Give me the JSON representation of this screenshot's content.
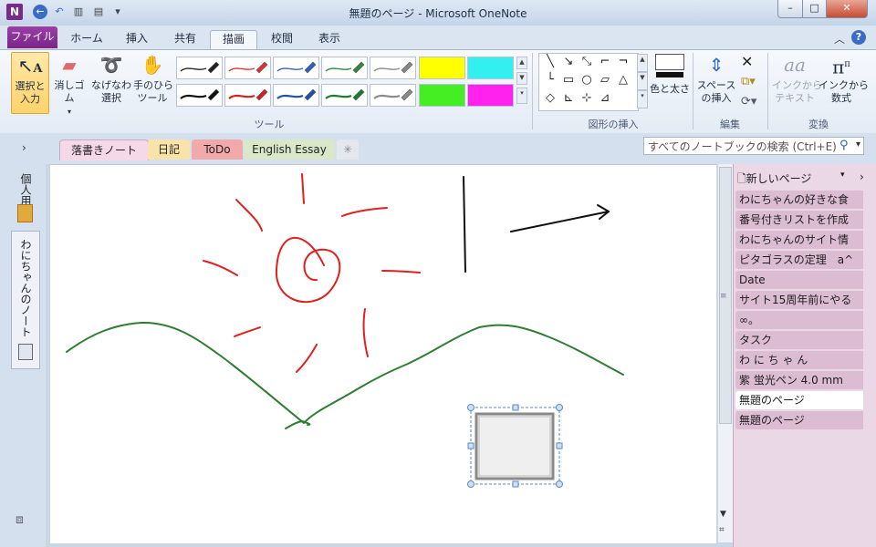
{
  "window": {
    "title": "無題のページ  -  Microsoft OneNote",
    "app_icon": "N"
  },
  "ribbon_tabs": [
    "ファイル",
    "ホーム",
    "挿入",
    "共有",
    "描画",
    "校閲",
    "表示"
  ],
  "active_tab": "描画",
  "tools_group": {
    "label": "ツール",
    "select_label": "選択と\n入力",
    "eraser_label": "消しゴム",
    "lasso_label": "なげなわ\n選択",
    "pan_label": "手のひら\nツール",
    "pens_row1": [
      "#222222",
      "#e03030",
      "#2f5fbf",
      "#2b8a3e",
      "#888888"
    ],
    "pens_row2": [
      "#111111",
      "#d42020",
      "#1f4fb0",
      "#1a7a2e",
      "#8a8a8a"
    ],
    "highlighters_row1": [
      "#ffff00",
      "#33f0f0"
    ],
    "highlighters_row2": [
      "#44ee22",
      "#ff22ee"
    ]
  },
  "shapes_group": {
    "label": "図形の挿入",
    "color_label": "色と太さ"
  },
  "edit_group": {
    "label": "編集",
    "space_label": "スペース\nの挿入"
  },
  "convert_group": {
    "label": "変換",
    "ink_text": "インクから\nテキスト",
    "ink_math": "インクから\n数式"
  },
  "notebook_tabs": [
    {
      "label": "落書きノート",
      "color": "#f5d9e8"
    },
    {
      "label": "日記",
      "color": "#f9e3a8"
    },
    {
      "label": "ToDo",
      "color": "#f2a9a9"
    },
    {
      "label": "English Essay",
      "color": "#d9e8c9"
    }
  ],
  "search": {
    "placeholder": "すべてのノートブックの検索 (Ctrl+E)"
  },
  "left_nav": {
    "personal": "個人用",
    "notebook": "わにちゃんのノート"
  },
  "page_list": {
    "new_page": "新しいページ",
    "pages": [
      "わにちゃんの好きな食",
      "番号付きリストを作成",
      "わにちゃんのサイト情",
      "ピタゴラスの定理　a^",
      "Date",
      "サイト15周年前にやる",
      "∞。",
      "タスク",
      "わ に ち ゃ ん",
      "紫 蛍光ペン 4.0 mm",
      "無題のページ",
      "無題のページ"
    ],
    "selected_index": 10
  },
  "colors": {
    "accent": "#7a2489",
    "sun": "#e02020",
    "hills": "#2e7d32",
    "ink": "#111111"
  }
}
